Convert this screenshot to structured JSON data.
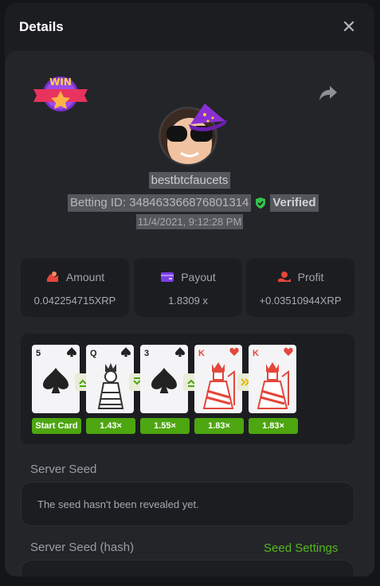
{
  "modal": {
    "title": "Details"
  },
  "player": {
    "username": "bestbtcfaucets",
    "betting_id_label": "Betting ID: 348463366876801314",
    "verified_label": "Verified",
    "timestamp": "11/4/2021, 9:12:28 PM",
    "badge_text": "WIN"
  },
  "stats": {
    "amount": {
      "label": "Amount",
      "value": "0.042254715XRP"
    },
    "payout": {
      "label": "Payout",
      "value": "1.8309 x"
    },
    "profit": {
      "label": "Profit",
      "value": "+0.03510944XRP"
    }
  },
  "game": {
    "cards": [
      {
        "rank": "5",
        "suit": "spade",
        "label": "Start Card"
      },
      {
        "rank": "Q",
        "suit": "spade",
        "label": "1.43×"
      },
      {
        "rank": "3",
        "suit": "spade",
        "label": "1.55×"
      },
      {
        "rank": "K",
        "suit": "heart",
        "label": "1.83×"
      },
      {
        "rank": "K",
        "suit": "heart",
        "label": "1.83×"
      }
    ],
    "guesses": [
      "higher",
      "lower",
      "higher",
      "skip"
    ]
  },
  "seeds": {
    "server_seed_label": "Server Seed",
    "server_seed_value": "The seed hasn't been revealed yet.",
    "server_seed_hash_label": "Server Seed (hash)",
    "seed_settings_link": "Seed Settings"
  },
  "colors": {
    "accent_green": "#4da60f",
    "link_green": "#53b81a",
    "heart_red": "#e4463b",
    "payout_purple": "#7b3fe4"
  }
}
